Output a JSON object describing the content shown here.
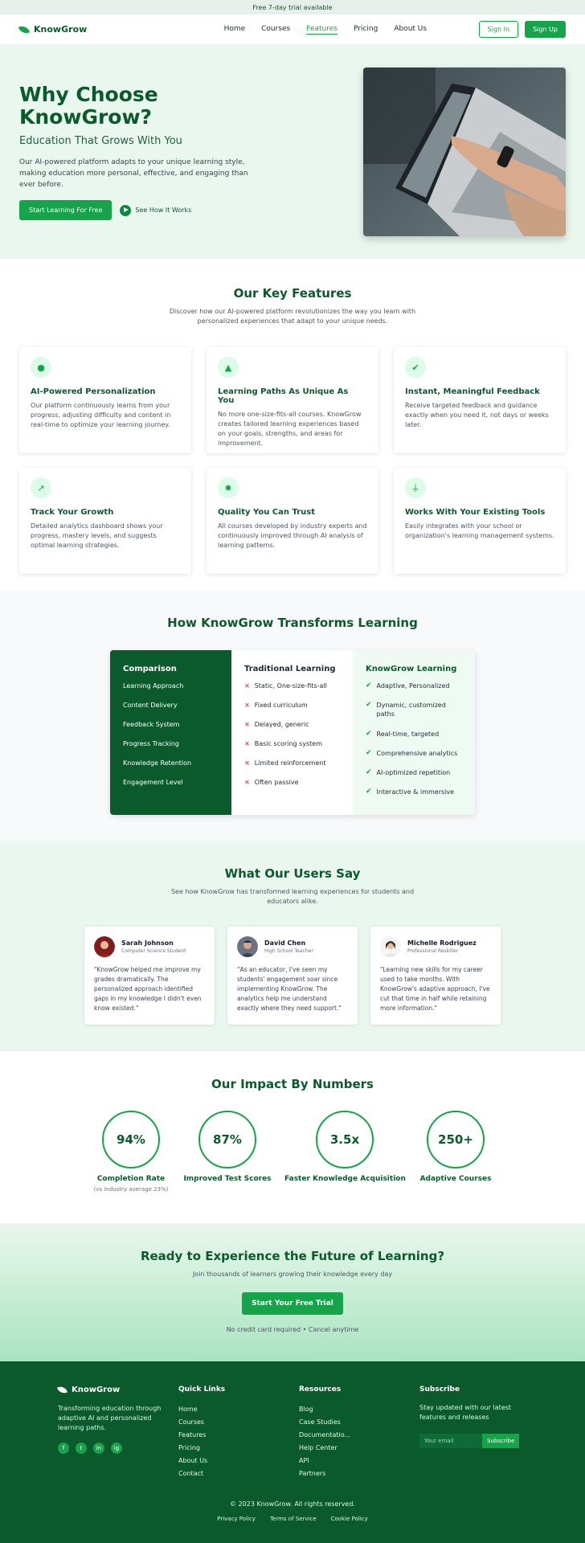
{
  "announcement": "Free 7-day trial available",
  "nav": {
    "brand": "KnowGrow",
    "links": [
      "Home",
      "Courses",
      "Features",
      "Pricing",
      "About Us"
    ],
    "active": "Features",
    "signin": "Sign In",
    "signup": "Sign Up"
  },
  "hero": {
    "title": "Why Choose KnowGrow?",
    "subtitle": "Education That Grows With You",
    "description": "Our AI-powered platform adapts to your unique learning style, making education more personal, effective, and engaging than ever before.",
    "cta_primary": "Start Learning For Free",
    "cta_secondary": "See How It Works"
  },
  "features": {
    "title": "Our Key Features",
    "subtitle": "Discover how our AI-powered platform revolutionizes the way you learn with personalized experiences that adapt to your unique needs.",
    "items": [
      {
        "icon": "brain-icon",
        "title": "AI-Powered Personalization",
        "text": "Our platform continuously learns from your progress, adjusting difficulty and content in real-time to optimize your learning journey."
      },
      {
        "icon": "road-icon",
        "title": "Learning Paths As Unique As You",
        "text": "No more one-size-fits-all courses. KnowGrow creates tailored learning experiences based on your goals, strengths, and areas for improvement."
      },
      {
        "icon": "check-circle-icon",
        "title": "Instant, Meaningful Feedback",
        "text": "Receive targeted feedback and guidance exactly when you need it, not days or weeks later."
      },
      {
        "icon": "chart-line-icon",
        "title": "Track Your Growth",
        "text": "Detailed analytics dashboard shows your progress, mastery levels, and suggests optimal learning strategies."
      },
      {
        "icon": "badge-icon",
        "title": "Quality You Can Trust",
        "text": "All courses developed by industry experts and continuously improved through AI analysis of learning patterns."
      },
      {
        "icon": "plug-icon",
        "title": "Works With Your Existing Tools",
        "text": "Easily integrates with your school or organization's learning management systems."
      }
    ]
  },
  "comparison": {
    "title": "How KnowGrow Transforms Learning",
    "col1": "Comparison",
    "col2": "Traditional Learning",
    "col3": "KnowGrow Learning",
    "rows": [
      {
        "label": "Learning Approach",
        "traditional": "Static, One-size-fits-all",
        "knowgrow": "Adaptive, Personalized"
      },
      {
        "label": "Content Delivery",
        "traditional": "Fixed curriculum",
        "knowgrow": "Dynamic, customized paths"
      },
      {
        "label": "Feedback System",
        "traditional": "Delayed, generic",
        "knowgrow": "Real-time, targeted"
      },
      {
        "label": "Progress Tracking",
        "traditional": "Basic scoring system",
        "knowgrow": "Comprehensive analytics"
      },
      {
        "label": "Knowledge Retention",
        "traditional": "Limited reinforcement",
        "knowgrow": "AI-optimized repetition"
      },
      {
        "label": "Engagement Level",
        "traditional": "Often passive",
        "knowgrow": "Interactive & immersive"
      }
    ]
  },
  "testimonials": {
    "title": "What Our Users Say",
    "subtitle": "See how KnowGrow has transformed learning experiences for students and educators alike.",
    "items": [
      {
        "name": "Sarah Johnson",
        "role": "Computer Science Student",
        "quote": "\"KnowGrow helped me improve my grades dramatically. The personalized approach identified gaps in my knowledge I didn't even know existed.\""
      },
      {
        "name": "David Chen",
        "role": "High School Teacher",
        "quote": "\"As an educator, I've seen my students' engagement soar since implementing KnowGrow. The analytics help me understand exactly where they need support.\""
      },
      {
        "name": "Michelle Rodriguez",
        "role": "Professional Reskiller",
        "quote": "\"Learning new skills for my career used to take months. With KnowGrow's adaptive approach, I've cut that time in half while retaining more information.\""
      }
    ]
  },
  "impact": {
    "title": "Our Impact By Numbers",
    "stats": [
      {
        "value": "94%",
        "label": "Completion Rate",
        "note": "(vs industry average 23%)"
      },
      {
        "value": "87%",
        "label": "Improved Test Scores",
        "note": ""
      },
      {
        "value": "3.5x",
        "label": "Faster Knowledge Acquisition",
        "note": ""
      },
      {
        "value": "250+",
        "label": "Adaptive Courses",
        "note": ""
      }
    ]
  },
  "cta": {
    "title": "Ready to Experience the Future of Learning?",
    "subtitle": "Join thousands of learners growing their knowledge every day",
    "button": "Start Your Free Trial",
    "small": "No credit card required • Cancel anytime"
  },
  "footer": {
    "brand": "KnowGrow",
    "description": "Transforming education through adaptive AI and personalized learning paths.",
    "social": [
      "f",
      "t",
      "in",
      "ig"
    ],
    "quick_title": "Quick Links",
    "quick_links": [
      "Home",
      "Courses",
      "Features",
      "Pricing",
      "About Us",
      "Contact"
    ],
    "resources_title": "Resources",
    "resources": [
      "Blog",
      "Case Studies",
      "Documentatio...",
      "Help Center",
      "API",
      "Partners"
    ],
    "subscribe_title": "Subscribe",
    "subscribe_text": "Stay updated with our latest features and releases",
    "email_placeholder": "Your email",
    "subscribe_button": "Subscribe",
    "copyright": "© 2023 KnowGrow. All rights reserved.",
    "legal": [
      "Privacy Policy",
      "Terms of Service",
      "Cookie Policy"
    ]
  },
  "colors": {
    "primary": "#16a34a",
    "dark": "#0b5a2c",
    "hero_bg": "#e9f7ee"
  }
}
